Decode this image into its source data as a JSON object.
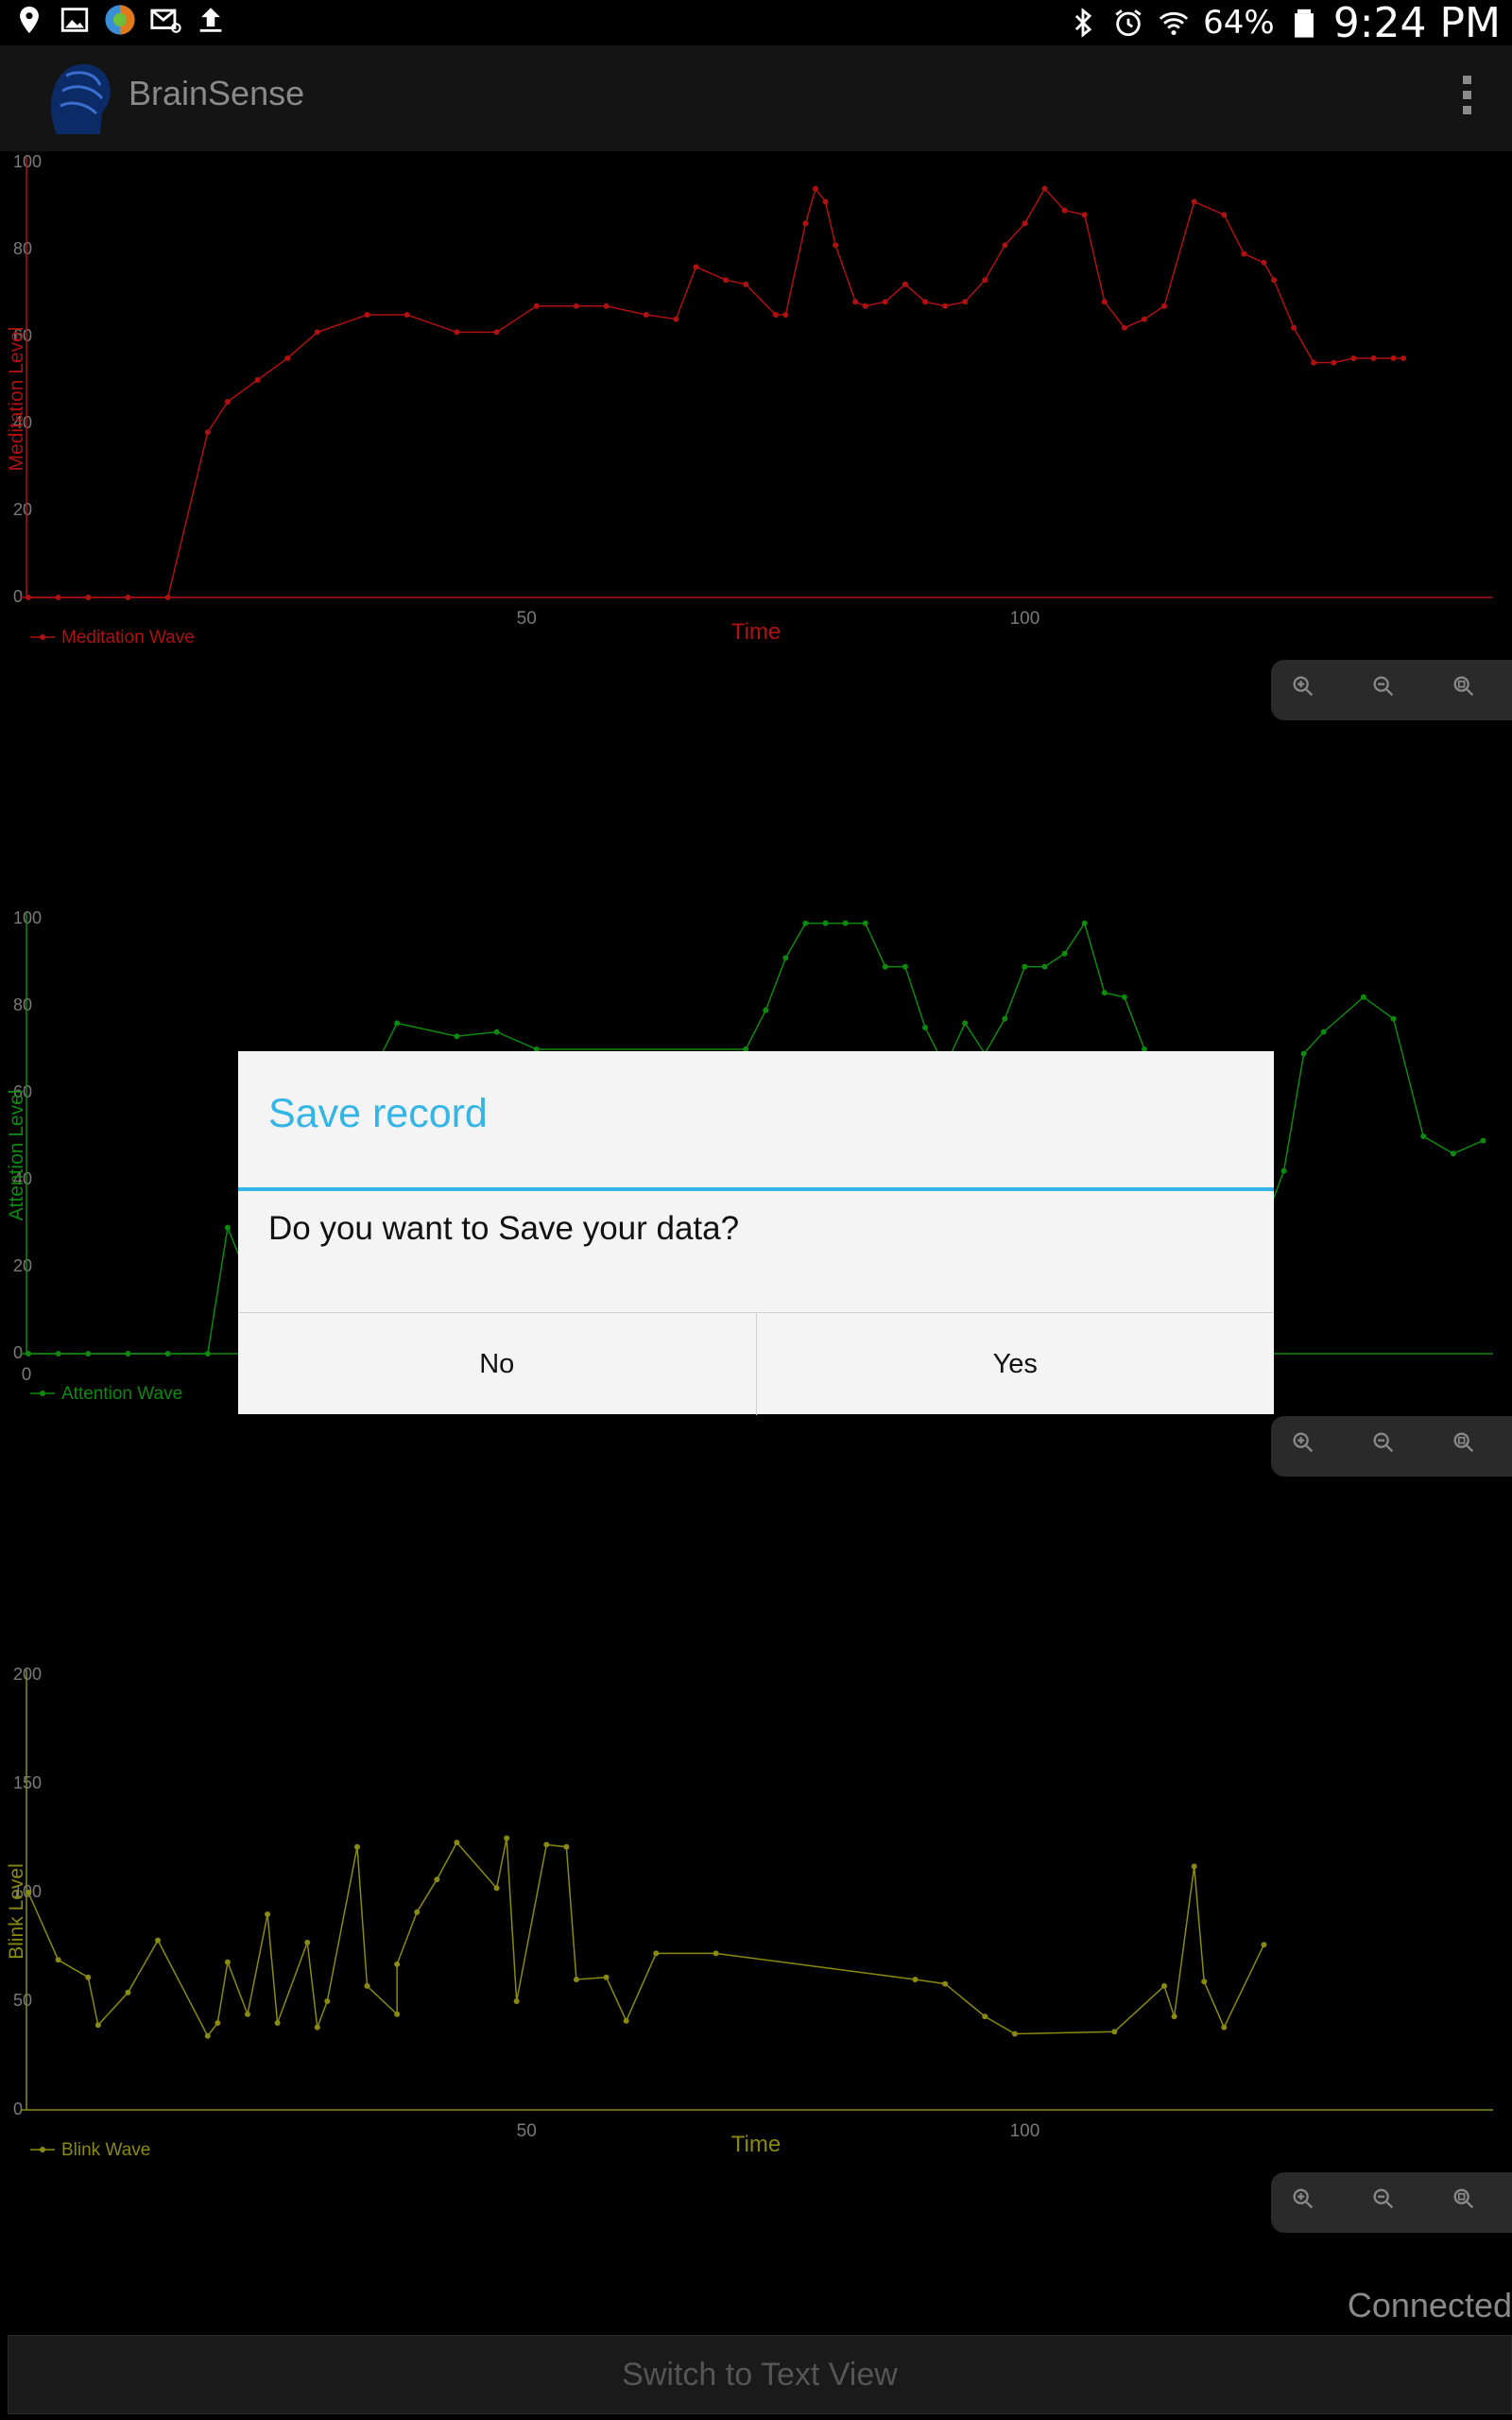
{
  "status_bar": {
    "battery": "64%",
    "time": "9:24 PM",
    "left_icons": [
      "location-pin-icon",
      "image-icon",
      "colorful-app-icon",
      "email-icon",
      "upload-icon"
    ],
    "right_icons": [
      "bluetooth-icon",
      "alarm-icon",
      "wifi-icon",
      "battery-icon"
    ]
  },
  "action_bar": {
    "title": "BrainSense"
  },
  "charts": [
    {
      "id": "meditation",
      "color": "#b01010",
      "ylabel": "Meditation Level",
      "xlabel": "Time",
      "legend": "Meditation Wave",
      "yticks": [
        "0",
        "20",
        "40",
        "60",
        "80",
        "100"
      ],
      "xticks": [
        "50",
        "100"
      ],
      "show_xlabel": true
    },
    {
      "id": "attention",
      "color": "#0d8a0d",
      "ylabel": "Attention Level",
      "xlabel": "",
      "legend": "Attention Wave",
      "yticks": [
        "0",
        "20",
        "40",
        "60",
        "80",
        "100"
      ],
      "xticks": [
        "0"
      ],
      "show_xlabel": false
    },
    {
      "id": "blink",
      "color": "#8a8a10",
      "ylabel": "Blink Level",
      "xlabel": "Time",
      "legend": "Blink Wave",
      "yticks": [
        "0",
        "50",
        "100",
        "150",
        "200"
      ],
      "xticks": [
        "50",
        "100"
      ],
      "show_xlabel": true
    }
  ],
  "chart_data": [
    {
      "type": "line",
      "series": [
        {
          "name": "Meditation Wave",
          "x": [
            0,
            3,
            6,
            10,
            14,
            18,
            20,
            23,
            26,
            29,
            34,
            38,
            43,
            47,
            51,
            55,
            58,
            62,
            65,
            67,
            70,
            72,
            75,
            76,
            78,
            79,
            80,
            81,
            83,
            84,
            86,
            88,
            90,
            92,
            94,
            96,
            98,
            100,
            102,
            104,
            106,
            108,
            110,
            112,
            114,
            117,
            120,
            122,
            124,
            125,
            127,
            129,
            131,
            133,
            135,
            137,
            138
          ],
          "values": [
            0,
            0,
            0,
            0,
            0,
            38,
            45,
            50,
            55,
            61,
            65,
            65,
            61,
            61,
            67,
            67,
            67,
            65,
            64,
            76,
            73,
            72,
            65,
            65,
            86,
            94,
            91,
            81,
            68,
            67,
            68,
            72,
            68,
            67,
            68,
            73,
            81,
            86,
            94,
            89,
            88,
            68,
            62,
            64,
            67,
            91,
            88,
            79,
            77,
            73,
            62,
            54,
            54,
            55,
            55,
            55,
            55
          ]
        }
      ],
      "xlabel": "Time",
      "ylabel": "Meditation Level",
      "xlim": [
        0,
        147
      ],
      "ylim": [
        0,
        100
      ]
    },
    {
      "type": "line",
      "series": [
        {
          "name": "Attention Wave",
          "x": [
            0,
            3,
            6,
            10,
            14,
            18,
            20,
            23,
            37,
            43,
            47,
            51,
            72,
            74,
            76,
            78,
            80,
            82,
            84,
            86,
            88,
            90,
            92,
            94,
            96,
            98,
            100,
            102,
            104,
            106,
            108,
            110,
            112,
            120,
            124,
            126,
            128,
            130,
            134,
            137,
            140,
            143,
            146
          ],
          "values": [
            0,
            0,
            0,
            0,
            0,
            0,
            29,
            12,
            76,
            73,
            74,
            70,
            70,
            79,
            91,
            99,
            99,
            99,
            99,
            89,
            89,
            75,
            66,
            76,
            69,
            77,
            89,
            89,
            92,
            99,
            83,
            82,
            70,
            44,
            30,
            42,
            69,
            74,
            82,
            77,
            50,
            46,
            49
          ]
        }
      ],
      "xlabel": "",
      "ylabel": "Attention Level",
      "xlim": [
        0,
        147
      ],
      "ylim": [
        0,
        100
      ]
    },
    {
      "type": "line",
      "series": [
        {
          "name": "Blink Wave",
          "x": [
            0,
            3,
            6,
            7,
            10,
            13,
            18,
            19,
            20,
            22,
            24,
            25,
            28,
            29,
            30,
            33,
            34,
            37,
            37,
            39,
            41,
            43,
            47,
            48,
            49,
            52,
            54,
            55,
            58,
            60,
            63,
            69,
            89,
            92,
            96,
            99,
            109,
            114,
            115,
            117,
            118,
            120,
            124
          ],
          "values": [
            100,
            69,
            61,
            39,
            54,
            78,
            34,
            40,
            68,
            44,
            90,
            40,
            77,
            38,
            50,
            121,
            57,
            44,
            67,
            91,
            106,
            123,
            102,
            125,
            50,
            122,
            121,
            60,
            61,
            41,
            72,
            72,
            60,
            58,
            43,
            35,
            36,
            57,
            43,
            112,
            59,
            38,
            76
          ]
        }
      ],
      "xlabel": "Time",
      "ylabel": "Blink Level",
      "xlim": [
        0,
        147
      ],
      "ylim": [
        0,
        200
      ]
    }
  ],
  "dialog": {
    "title": "Save record",
    "message": "Do you want to Save your data?",
    "no_label": "No",
    "yes_label": "Yes"
  },
  "footer": {
    "status": "Connected",
    "switch_label": "Switch to Text View"
  }
}
